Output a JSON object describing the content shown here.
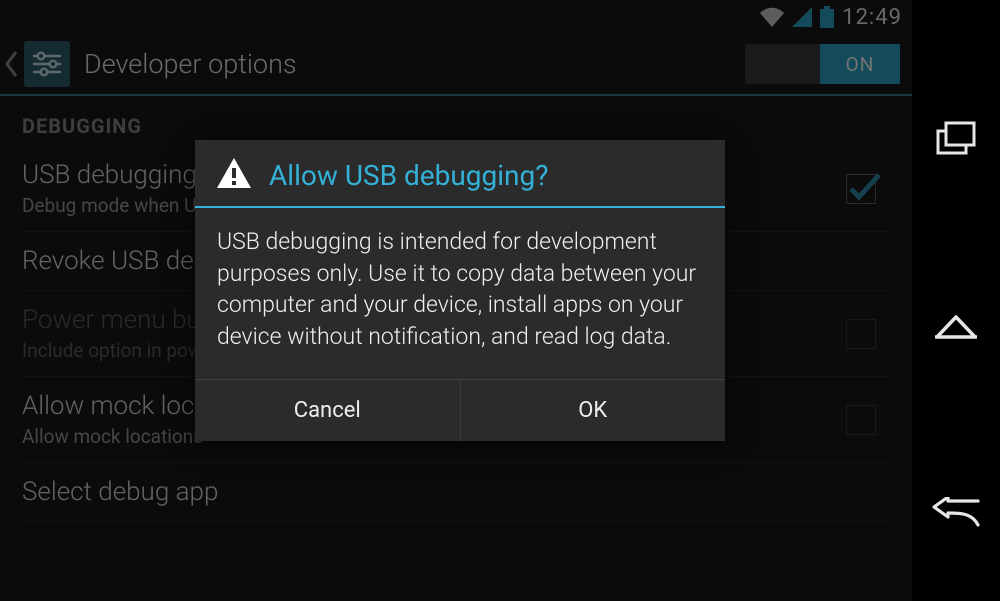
{
  "status": {
    "clock": "12:49"
  },
  "actionbar": {
    "title": "Developer options",
    "switch_label": "ON"
  },
  "sections": {
    "debugging_header": "DEBUGGING"
  },
  "rows": {
    "usb_debug": {
      "title": "USB debugging",
      "sub": "Debug mode when USB is connected"
    },
    "revoke": {
      "title": "Revoke USB debugging authorizations"
    },
    "power_menu": {
      "title": "Power menu bug reports",
      "sub": "Include option in power menu for taking a bug report"
    },
    "mock": {
      "title": "Allow mock locations",
      "sub": "Allow mock locations"
    },
    "select_app": {
      "title": "Select debug app"
    }
  },
  "dialog": {
    "title": "Allow USB debugging?",
    "body": "USB debugging is intended for development purposes only. Use it to copy data between your computer and your device, install apps on your device without notification, and read log data.",
    "cancel": "Cancel",
    "ok": "OK"
  }
}
